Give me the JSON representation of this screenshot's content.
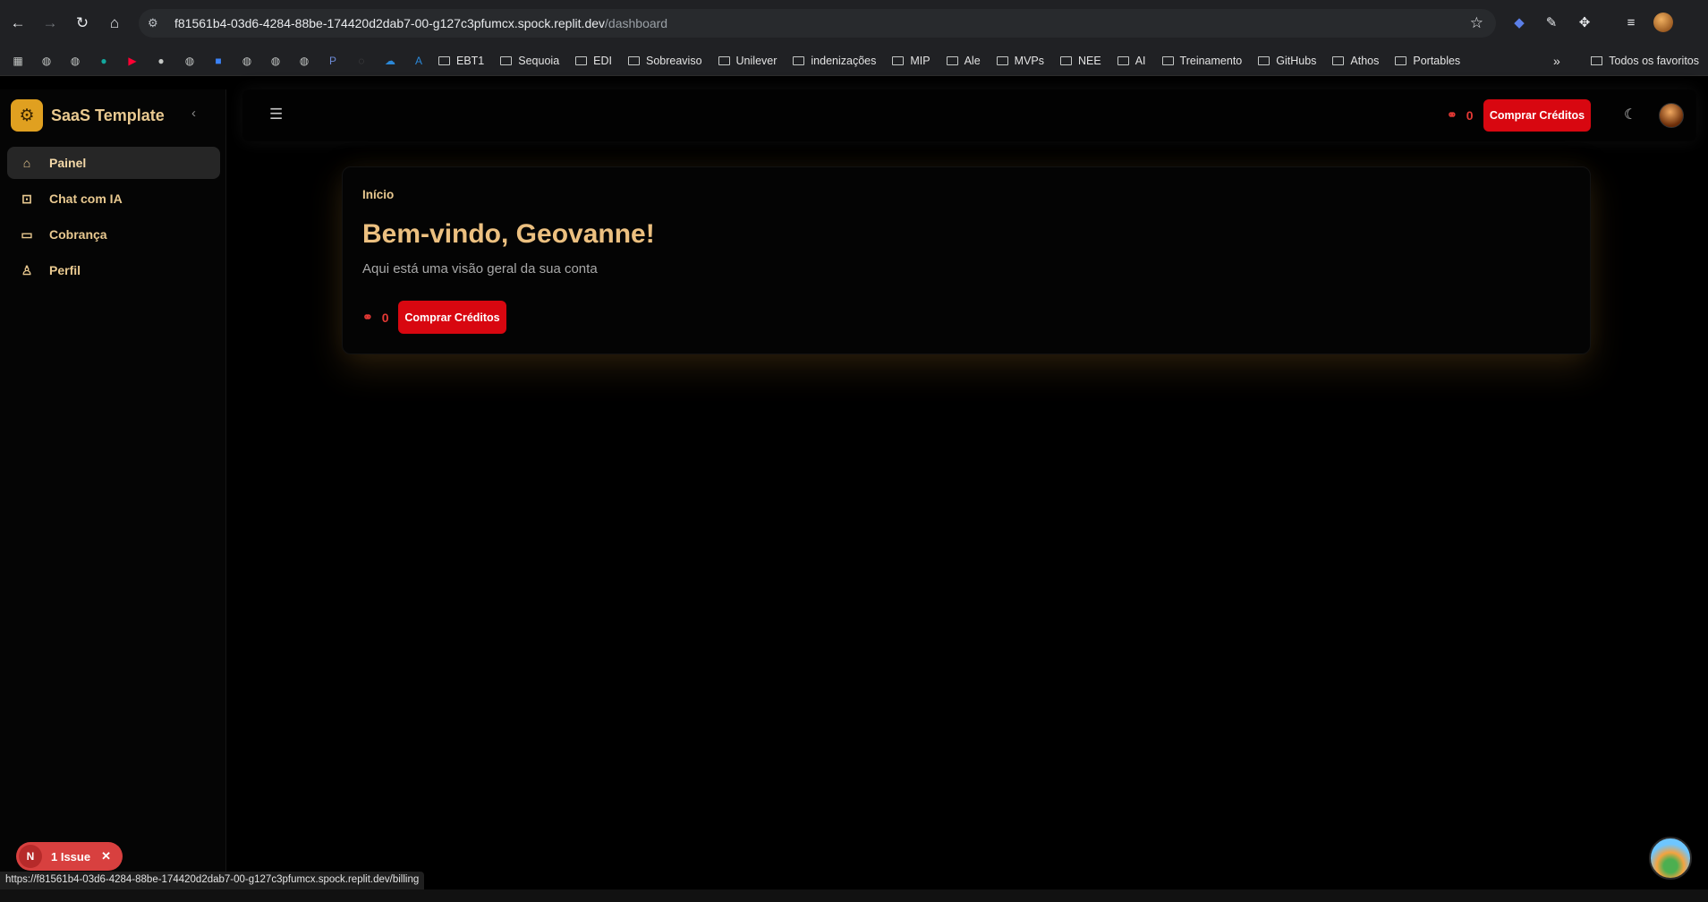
{
  "browser": {
    "url_host": "f81561b4-03d6-4284-88be-174420d2dab7-00-g127c3pfumcx.spock.replit.dev",
    "url_path": "/dashboard",
    "bookmarks": [
      "EBT1",
      "Sequoia",
      "EDI",
      "Sobreaviso",
      "Unilever",
      "indenizações",
      "MIP",
      "Ale",
      "MVPs",
      "NEE",
      "AI",
      "Treinamento",
      "GitHubs",
      "Athos",
      "Portables"
    ],
    "all_bookmarks": "Todos os favoritos",
    "more": "»",
    "status_url": "https://f81561b4-03d6-4284-88be-174420d2dab7-00-g127c3pfumcx.spock.replit.dev/billing"
  },
  "sidebar": {
    "brand": "SaaS Template",
    "items": [
      {
        "label": "Painel",
        "icon": "home-icon"
      },
      {
        "label": "Chat com IA",
        "icon": "robot-icon"
      },
      {
        "label": "Cobrança",
        "icon": "credit-card-icon"
      },
      {
        "label": "Perfil",
        "icon": "user-icon"
      }
    ]
  },
  "header": {
    "credits": "0",
    "buy_label": "Comprar Créditos"
  },
  "main": {
    "breadcrumb": "Início",
    "welcome": "Bem-vindo, Geovanne!",
    "subtitle": "Aqui está uma visão geral da sua conta",
    "credits": "0",
    "buy_label": "Comprar Créditos"
  },
  "issue_badge": {
    "label": "1 Issue"
  },
  "colors": {
    "accent": "#d80710",
    "brand_gold": "#e0a020",
    "text_gold": "#e9c990"
  }
}
